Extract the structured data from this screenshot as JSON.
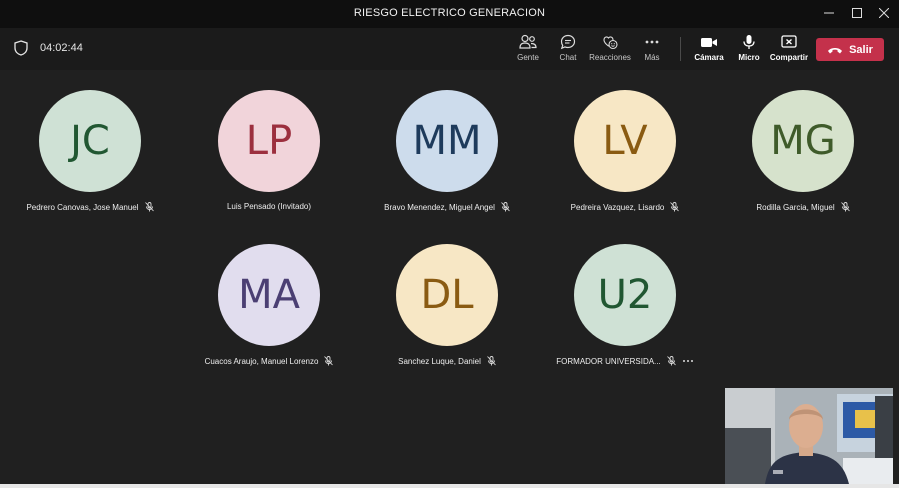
{
  "window": {
    "title": "RIESGO ELECTRICO GENERACION"
  },
  "toolbar": {
    "timer": "04:02:44",
    "people_label": "Gente",
    "chat_label": "Chat",
    "reactions_label": "Reacciones",
    "more_label": "Más",
    "camera_label": "Cámara",
    "mic_label": "Micro",
    "share_label": "Compartir",
    "leave_label": "Salir"
  },
  "participants": [
    {
      "initials": "JC",
      "name": "Pedrero Canovas, Jose Manuel",
      "bg": "#cfe1d5",
      "fg": "#215732"
    },
    {
      "initials": "LP",
      "name": "Luis Pensado (Invitado)",
      "bg": "#f1d4da",
      "fg": "#9c2f3e"
    },
    {
      "initials": "MM",
      "name": "Bravo Menendez, Miguel Angel",
      "bg": "#cddcec",
      "fg": "#1e3b5c"
    },
    {
      "initials": "LV",
      "name": "Pedreira Vazquez, Lisardo",
      "bg": "#f7e7c5",
      "fg": "#8a5b12"
    },
    {
      "initials": "MG",
      "name": "Rodilla Garcia, Miguel",
      "bg": "#d6e2cc",
      "fg": "#3f5b2a"
    },
    {
      "initials": "MA",
      "name": "Cuacos Araujo, Manuel Lorenzo",
      "bg": "#e1ddee",
      "fg": "#4b3f73"
    },
    {
      "initials": "DL",
      "name": "Sanchez Luque, Daniel",
      "bg": "#f7e7c5",
      "fg": "#8a5b12"
    },
    {
      "initials": "U2",
      "name": "FORMADOR UNIVERSIDA...",
      "bg": "#cfe1d5",
      "fg": "#215732"
    }
  ]
}
